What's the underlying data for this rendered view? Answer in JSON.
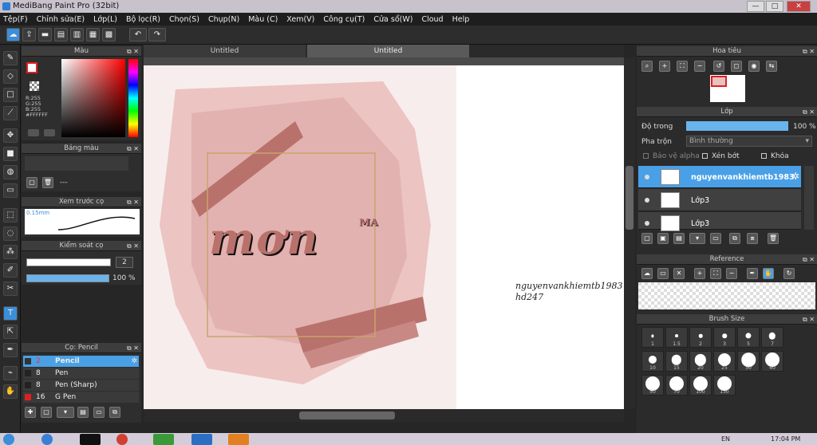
{
  "window": {
    "title": "MediBang Paint Pro (32bit)",
    "minimize": "—",
    "maximize": "□",
    "close": "✕"
  },
  "menu": [
    "Tệp(F)",
    "Chỉnh sửa(E)",
    "Lớp(L)",
    "Bộ lọc(R)",
    "Chọn(S)",
    "Chụp(N)",
    "Màu (C)",
    "Xem(V)",
    "Công cụ(T)",
    "Cửa sổ(W)",
    "Cloud",
    "Help"
  ],
  "color_panel": {
    "title": "Màu",
    "r": "R:255",
    "g": "G:255",
    "b": "B:255",
    "hex": "#FFFFFF"
  },
  "palette_panel": {
    "title": "Bảng màu",
    "empty": "---"
  },
  "brush_preview": {
    "title": "Xem trước cọ",
    "size": "0.15mm"
  },
  "brush_control": {
    "title": "Kiểm soát cọ",
    "size_value": "2",
    "opacity_value": "100 %",
    "opacity": 1.0
  },
  "brush_list": {
    "title": "Cọ: Pencil",
    "items": [
      {
        "size": "2",
        "name": "Pencil",
        "selected": true
      },
      {
        "size": "8",
        "name": "Pen"
      },
      {
        "size": "8",
        "name": "Pen (Sharp)"
      },
      {
        "size": "16",
        "name": "G Pen"
      }
    ]
  },
  "tabs": [
    "Untitled",
    "Untitled"
  ],
  "canvas": {
    "text_main": "mơn",
    "text_sup": "ᴹᴬ",
    "signature_1": "nguyenvankhiemtb1983",
    "signature_2": "hd247"
  },
  "navigator": {
    "title": "Hoa tiêu"
  },
  "layer_panel": {
    "title": "Lớp",
    "opacity_label": "Độ trong",
    "opacity_value": "100 %",
    "opacity": 1.0,
    "blend_label": "Pha trộn",
    "blend_value": "Bình thường",
    "protect_alpha": "Bảo vệ alpha",
    "clipping": "Xén bớt",
    "lock": "Khóa",
    "layers": [
      {
        "name": "nguyenvankhiemtb1983",
        "selected": true
      },
      {
        "name": "Lớp3"
      },
      {
        "name": "Lớp3"
      }
    ]
  },
  "reference_panel": {
    "title": "Reference"
  },
  "brush_size_panel": {
    "title": "Brush Size",
    "sizes": [
      "1",
      "1.5",
      "2",
      "3",
      "5",
      "7",
      "10",
      "15",
      "20",
      "25",
      "30",
      "40",
      "50",
      "70",
      "100",
      "130"
    ]
  },
  "taskbar": {
    "lang": "EN",
    "time": "17:04 PM"
  },
  "colors": {
    "accent": "#3c8ed8",
    "selection": "#4aa0e6",
    "panel": "#2e2e2e",
    "foreground_color": "#ffffff",
    "background_swatch": "#e02020"
  }
}
